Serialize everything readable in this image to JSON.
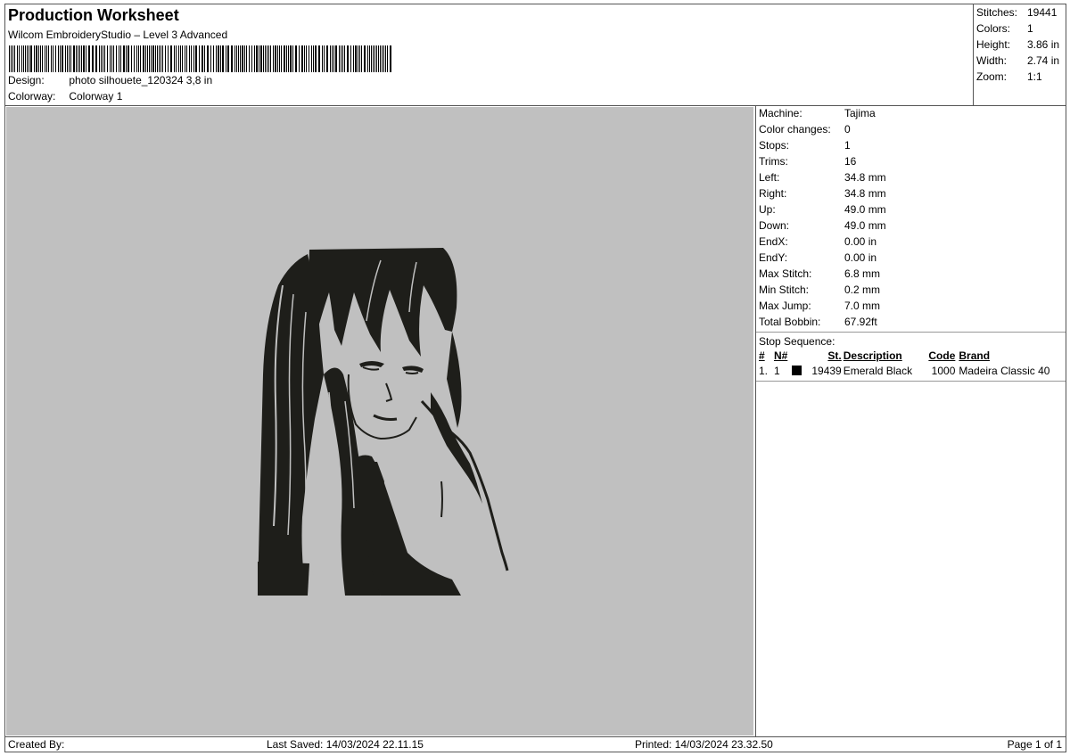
{
  "header": {
    "title": "Production Worksheet",
    "subtitle": "Wilcom EmbroideryStudio – Level 3 Advanced",
    "design_label": "Design:",
    "design_value": "photo silhouete_120324 3,8 in",
    "colorway_label": "Colorway:",
    "colorway_value": "Colorway 1"
  },
  "stats": [
    {
      "label": "Stitches:",
      "value": "19441"
    },
    {
      "label": "Colors:",
      "value": "1"
    },
    {
      "label": "Height:",
      "value": "3.86 in"
    },
    {
      "label": "Width:",
      "value": "2.74 in"
    },
    {
      "label": "Zoom:",
      "value": "1:1"
    }
  ],
  "machine": [
    {
      "label": "Machine:",
      "value": "Tajima"
    },
    {
      "label": "Color changes:",
      "value": "0"
    },
    {
      "label": "Stops:",
      "value": "1"
    },
    {
      "label": "Trims:",
      "value": "16"
    },
    {
      "label": "Left:",
      "value": "34.8 mm"
    },
    {
      "label": "Right:",
      "value": "34.8 mm"
    },
    {
      "label": "Up:",
      "value": "49.0 mm"
    },
    {
      "label": "Down:",
      "value": "49.0 mm"
    },
    {
      "label": "EndX:",
      "value": "0.00 in"
    },
    {
      "label": "EndY:",
      "value": "0.00 in"
    },
    {
      "label": "Max Stitch:",
      "value": "6.8 mm"
    },
    {
      "label": "Min Stitch:",
      "value": "0.2 mm"
    },
    {
      "label": "Max Jump:",
      "value": "7.0 mm"
    },
    {
      "label": "Total Bobbin:",
      "value": "67.92ft"
    }
  ],
  "stop_sequence": {
    "title": "Stop Sequence:",
    "columns": [
      "#",
      "N#",
      "St.",
      "Description",
      "Code",
      "Brand"
    ],
    "rows": [
      {
        "index": "1.",
        "n": "1",
        "swatch_color": "#000000",
        "stitches": "19439",
        "description": "Emerald Black",
        "code": "1000",
        "brand": "Madeira Classic 40"
      }
    ]
  },
  "footer": {
    "created_by": "Created By:",
    "last_saved": "Last Saved: 14/03/2024 22.11.15",
    "printed": "Printed: 14/03/2024 23.32.50",
    "page": "Page 1 of 1"
  },
  "colors": {
    "canvas_bg": "#c0c0c0",
    "thread": "#1e1e1a"
  }
}
